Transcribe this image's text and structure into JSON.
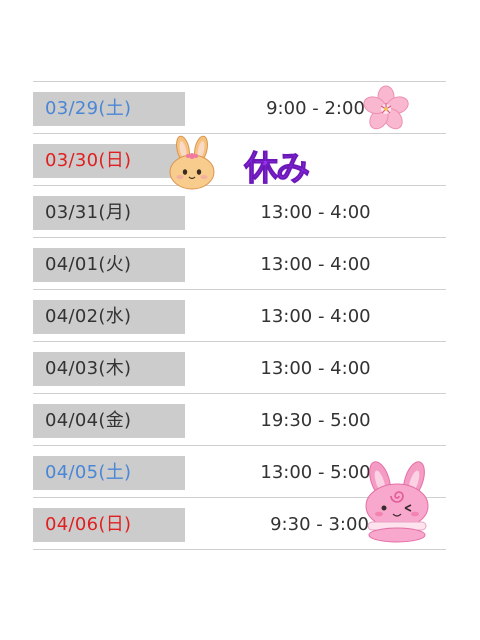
{
  "schedule": {
    "rows": [
      {
        "date": "03/29(土)",
        "time": "9:00 - 2:00",
        "day_type": "sat"
      },
      {
        "date": "03/30(日)",
        "time": "",
        "day_type": "sun"
      },
      {
        "date": "03/31(月)",
        "time": "13:00 - 4:00",
        "day_type": "weekday"
      },
      {
        "date": "04/01(火)",
        "time": "13:00 - 4:00",
        "day_type": "weekday"
      },
      {
        "date": "04/02(水)",
        "time": "13:00 - 4:00",
        "day_type": "weekday"
      },
      {
        "date": "04/03(木)",
        "time": "13:00 - 4:00",
        "day_type": "weekday"
      },
      {
        "date": "04/04(金)",
        "time": "19:30 - 5:00",
        "day_type": "weekday"
      },
      {
        "date": "04/05(土)",
        "time": "13:00 - 5:00",
        "day_type": "sat"
      },
      {
        "date": "04/06(日)",
        "time": "9:30 - 3:00",
        "day_type": "sun"
      }
    ],
    "day_off_label": "休み"
  },
  "colors": {
    "saturday": "#4a86d6",
    "sunday": "#e02020",
    "weekday": "#333333",
    "date_bg": "#cccccc",
    "day_off": "#9b2ff0"
  },
  "stickers": [
    "sakura-flower-icon",
    "bunny-face-icon",
    "pink-bunny-macaron-icon"
  ]
}
